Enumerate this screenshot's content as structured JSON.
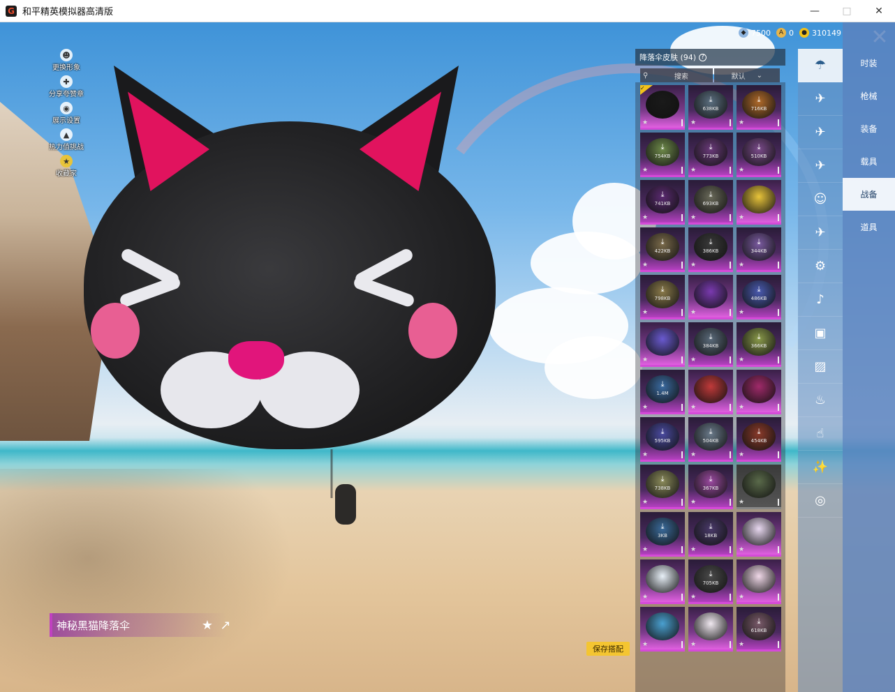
{
  "window": {
    "title": "和平精英模拟器高清版",
    "icon": "G"
  },
  "currencies": [
    {
      "icon": "gem-icon",
      "value": "7500",
      "color": "#8fb6e0"
    },
    {
      "icon": "coin-a-icon",
      "value": "0",
      "color": "#e8b54a"
    },
    {
      "icon": "coin-gold-icon",
      "value": "310149",
      "color": "#f2c21b"
    }
  ],
  "left_menu": [
    {
      "label": "更换形象",
      "icon": "avatar-icon"
    },
    {
      "label": "分享夸赞章",
      "icon": "share-badge-icon"
    },
    {
      "label": "展示设置",
      "icon": "eye-icon"
    },
    {
      "label": "热力值挑战",
      "icon": "flame-icon"
    },
    {
      "label": "收藏家",
      "icon": "collector-icon"
    }
  ],
  "item_name": "神秘黑猫降落伞",
  "save_label": "保存搭配",
  "panel": {
    "title": "降落伞皮肤 (94)",
    "search_placeholder": "搜索",
    "sort_label": "默认"
  },
  "grid": [
    {
      "size": "",
      "color": "#1a1a1a",
      "selected": true,
      "download": false,
      "tone": "pink"
    },
    {
      "size": "638KB",
      "color": "#5b6f80",
      "download": true,
      "tone": ""
    },
    {
      "size": "716KB",
      "color": "#b06a2a",
      "download": true,
      "tone": ""
    },
    {
      "size": "754KB",
      "color": "#6e8a4a",
      "download": true,
      "tone": ""
    },
    {
      "size": "773KB",
      "color": "#6a3a7a",
      "download": true,
      "tone": ""
    },
    {
      "size": "510KB",
      "color": "#7a4a8a",
      "download": true,
      "tone": ""
    },
    {
      "size": "741KB",
      "color": "#5a2a70",
      "download": true,
      "tone": ""
    },
    {
      "size": "693KB",
      "color": "#6a6a5a",
      "download": true,
      "tone": ""
    },
    {
      "size": "",
      "color": "#e8c43a",
      "download": false,
      "tone": "pink"
    },
    {
      "size": "422KB",
      "color": "#7a6a4a",
      "download": true,
      "tone": ""
    },
    {
      "size": "386KB",
      "color": "#3a3a3a",
      "download": true,
      "tone": ""
    },
    {
      "size": "344KB",
      "color": "#7a5aa0",
      "download": true,
      "tone": ""
    },
    {
      "size": "798KB",
      "color": "#8a7a4a",
      "download": true,
      "tone": ""
    },
    {
      "size": "",
      "color": "#7a3ab0",
      "download": false,
      "tone": "pink"
    },
    {
      "size": "486KB",
      "color": "#4a5ab0",
      "download": true,
      "tone": ""
    },
    {
      "size": "",
      "color": "#6a5ad0",
      "download": false,
      "tone": "pink"
    },
    {
      "size": "384KB",
      "color": "#5a6a7a",
      "download": true,
      "tone": ""
    },
    {
      "size": "366KB",
      "color": "#8a9a4a",
      "download": true,
      "tone": ""
    },
    {
      "size": "1.4M",
      "color": "#3a6aa0",
      "download": true,
      "tone": ""
    },
    {
      "size": "",
      "color": "#c03a3a",
      "download": false,
      "tone": "pink"
    },
    {
      "size": "",
      "color": "#a02a6a",
      "download": false,
      "tone": "pink"
    },
    {
      "size": "595KB",
      "color": "#4a4aa0",
      "download": true,
      "tone": ""
    },
    {
      "size": "504KB",
      "color": "#6a7a8a",
      "download": true,
      "tone": ""
    },
    {
      "size": "454KB",
      "color": "#8a3a2a",
      "download": true,
      "tone": ""
    },
    {
      "size": "738KB",
      "color": "#8a8a5a",
      "download": true,
      "tone": ""
    },
    {
      "size": "367KB",
      "color": "#9a4aa0",
      "download": true,
      "tone": ""
    },
    {
      "size": "",
      "color": "#5a6a4a",
      "download": false,
      "tone": "grey"
    },
    {
      "size": "3KB",
      "color": "#3a6a9a",
      "download": true,
      "tone": ""
    },
    {
      "size": "18KB",
      "color": "#4a3a6a",
      "download": true,
      "tone": ""
    },
    {
      "size": "",
      "color": "#e8d8f0",
      "download": false,
      "tone": "pink"
    },
    {
      "size": "",
      "color": "#e8f0f8",
      "download": false,
      "tone": "pink"
    },
    {
      "size": "705KB",
      "color": "#4a4a4a",
      "download": true,
      "tone": ""
    },
    {
      "size": "",
      "color": "#f0d8e8",
      "download": false,
      "tone": "pink"
    },
    {
      "size": "",
      "color": "#4aa0d0",
      "download": false,
      "tone": "pink"
    },
    {
      "size": "",
      "color": "#f0e8f0",
      "download": false,
      "tone": "pink"
    },
    {
      "size": "618KB",
      "color": "#7a5a6a",
      "download": true,
      "tone": ""
    }
  ],
  "category_icons": [
    "parachute-icon",
    "glider-icon",
    "plane-icon",
    "jet-icon",
    "emote-icon",
    "fighter-icon",
    "robot-icon",
    "speaker-icon",
    "chat-bubble-icon",
    "photo-icon",
    "extinguisher-icon",
    "hand-tap-icon",
    "magic-wand-icon",
    "ufo-icon"
  ],
  "tabs": [
    {
      "label": "时装",
      "active": false
    },
    {
      "label": "枪械",
      "active": false
    },
    {
      "label": "装备",
      "active": false
    },
    {
      "label": "载具",
      "active": false
    },
    {
      "label": "战备",
      "active": true
    },
    {
      "label": "道具",
      "active": false
    }
  ]
}
